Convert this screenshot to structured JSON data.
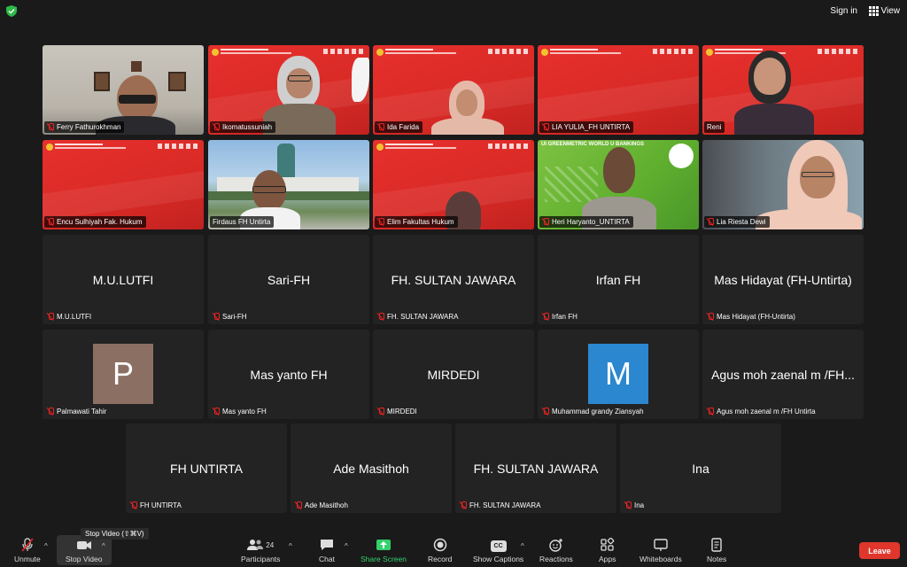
{
  "topbar": {
    "signin": "Sign in",
    "view": "View"
  },
  "video_tiles": [
    {
      "name": "Ferry Fathurokhman"
    },
    {
      "name": "Ikomatussuniah"
    },
    {
      "name": "Ida Farida"
    },
    {
      "name": "LIA YULIA_FH UNTIRTA"
    },
    {
      "name": "Reni"
    },
    {
      "name": "Encu Sulhiyah Fak. Hukum"
    },
    {
      "name": "Firdaus FH Untirta"
    },
    {
      "name": "Elim Fakultas Hukum"
    },
    {
      "name": "Heri Haryanto_UNTIRTA",
      "banner": "UI GREENMETRIC WORLD U    BANKINGS"
    },
    {
      "name": "Lia Riesta Dewi"
    }
  ],
  "name_tiles": [
    {
      "display": "M.U.LUTFI",
      "label": "M.U.LUTFI"
    },
    {
      "display": "Sari-FH",
      "label": "Sari-FH"
    },
    {
      "display": "FH. SULTAN JAWARA",
      "label": "FH. SULTAN JAWARA"
    },
    {
      "display": "Irfan FH",
      "label": "Irfan FH"
    },
    {
      "display": "Mas Hidayat (FH-Untirta)",
      "label": "Mas Hidayat (FH-Untirta)"
    },
    {
      "display": "",
      "label": "Palmawati Tahir",
      "avatar": "P",
      "avatar_color": "#8c6f63"
    },
    {
      "display": "Mas yanto FH",
      "label": "Mas yanto FH"
    },
    {
      "display": "MIRDEDI",
      "label": "MIRDEDI"
    },
    {
      "display": "",
      "label": "Muhammad grandy Ziansyah",
      "avatar": "M",
      "avatar_color": "#2b87cf"
    },
    {
      "display": "Agus moh zaenal m /FH...",
      "label": "Agus moh zaenal m /FH Untirta"
    },
    {
      "display": "FH UNTIRTA",
      "label": "FH UNTIRTA"
    },
    {
      "display": "Ade Masithoh",
      "label": "Ade Masithoh"
    },
    {
      "display": "FH. SULTAN JAWARA",
      "label": "FH. SULTAN JAWARA"
    },
    {
      "display": "Ina",
      "label": "Ina"
    }
  ],
  "toolbar": {
    "unmute": "Unmute",
    "stop_video": "Stop Video",
    "tooltip": "Stop Video (⇧⌘V)",
    "participants": "Participants",
    "participant_count": "24",
    "chat": "Chat",
    "share_screen": "Share Screen",
    "record": "Record",
    "show_captions": "Show Captions",
    "captions_badge": "CC",
    "reactions": "Reactions",
    "apps": "Apps",
    "whiteboards": "Whiteboards",
    "notes": "Notes",
    "leave": "Leave"
  },
  "colors": {
    "active_speaker": "#3cc93c",
    "leave": "#e0362c",
    "share": "#33d06b",
    "muted": "#e22222"
  }
}
